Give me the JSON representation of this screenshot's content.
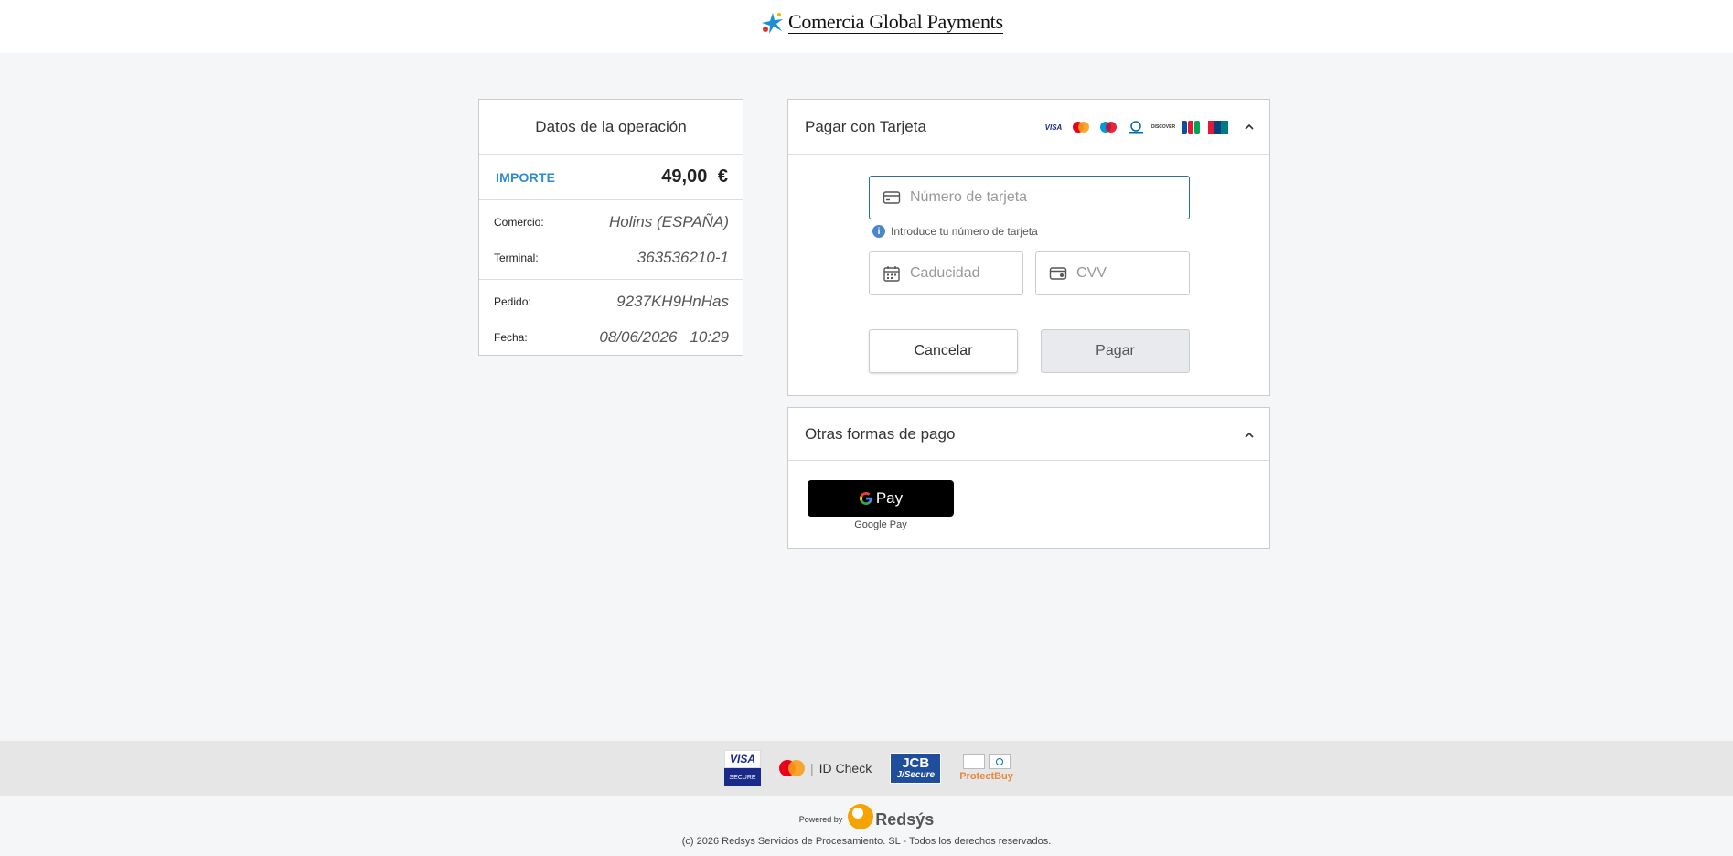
{
  "header": {
    "brand_name": "Comercia Global Payments"
  },
  "operation": {
    "title": "Datos de la operación",
    "amount_label": "IMPORTE",
    "amount_value": "49,00 €",
    "rows": [
      {
        "key": "Comercio:",
        "value": "Holins (ESPAÑA)"
      },
      {
        "key": "Terminal:",
        "value": "363536210-1"
      },
      {
        "key": "Pedido:",
        "value": "9237KH9HnHas"
      },
      {
        "key": "Fecha:",
        "date": "08/06/2026",
        "time": "10:29"
      }
    ]
  },
  "card_payment": {
    "title": "Pagar con Tarjeta",
    "brands": [
      "VISA",
      "mastercard",
      "maestro",
      "diners",
      "DISCOVER",
      "JCB",
      "UnionPay"
    ],
    "card_number_placeholder": "Número de tarjeta",
    "card_number_hint": "Introduce tu número de tarjeta",
    "expiry_placeholder": "Caducidad",
    "cvv_placeholder": "CVV",
    "cancel_label": "Cancelar",
    "pay_label": "Pagar"
  },
  "other_payments": {
    "title": "Otras formas de pago",
    "gpay_button_text": "Pay",
    "gpay_label": "Google Pay"
  },
  "footer": {
    "visa_top": "VISA",
    "visa_bottom": "SECURE",
    "idcheck": "ID Check",
    "jcb_top": "JCB",
    "jcb_bottom": "J/Secure",
    "protectbuy": "ProtectBuy",
    "powered_by": "Powered by",
    "redsys": "Redsýs",
    "copyright": "(c) 2026 Redsys Servicios de Procesamiento. SL - Todos los derechos reservados."
  },
  "colors": {
    "accent": "#2e8bd0",
    "focus_border": "#2e6c9c",
    "gpay_bg": "#000000"
  }
}
